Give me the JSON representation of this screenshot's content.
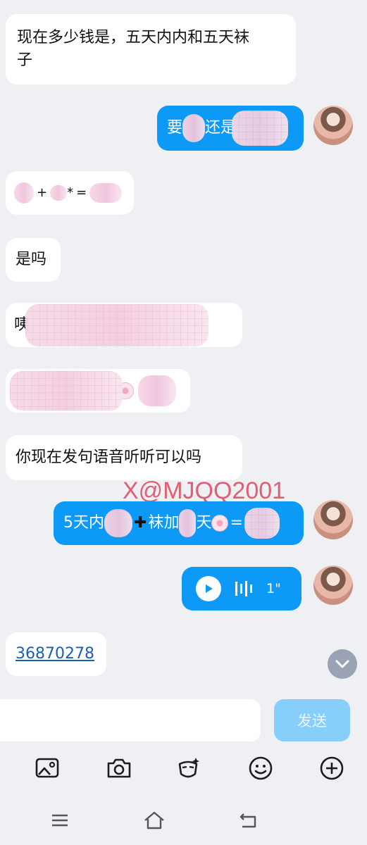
{
  "colors": {
    "background": "#eff0f4",
    "incoming_bubble": "#ffffff",
    "outgoing_bubble": "#0d9af6",
    "send_button": "#85cffa",
    "link": "#1a5fb4",
    "watermark": "#dc465a"
  },
  "messages": {
    "m1": {
      "line1": "现在多少钱是，五天内内和五天袜",
      "line2": "子"
    },
    "m2": {
      "prefix": "要",
      "middle": "还是"
    },
    "m3": {
      "plus": "+",
      "star": "*",
      "eq": "="
    },
    "m4": {
      "text": "是吗"
    },
    "m5": {
      "prefix": "咦"
    },
    "m7": {
      "text": "你现在发句语音听听可以吗"
    },
    "m8": {
      "prefix": "5天内",
      "plus": "✚",
      "mid": "袜加",
      "tian": "天",
      "eq": "="
    },
    "m9": {
      "duration": "1\""
    },
    "m10": {
      "link": "36870278"
    }
  },
  "watermark": "X@MJQQ2001",
  "input": {
    "value": "",
    "placeholder": ""
  },
  "send_label": "发送",
  "toolbar_icons": [
    "image-icon",
    "camera-icon",
    "sticker-icon",
    "emoji-icon",
    "plus-icon"
  ],
  "nav_icons": [
    "menu-icon",
    "home-icon",
    "back-icon"
  ]
}
